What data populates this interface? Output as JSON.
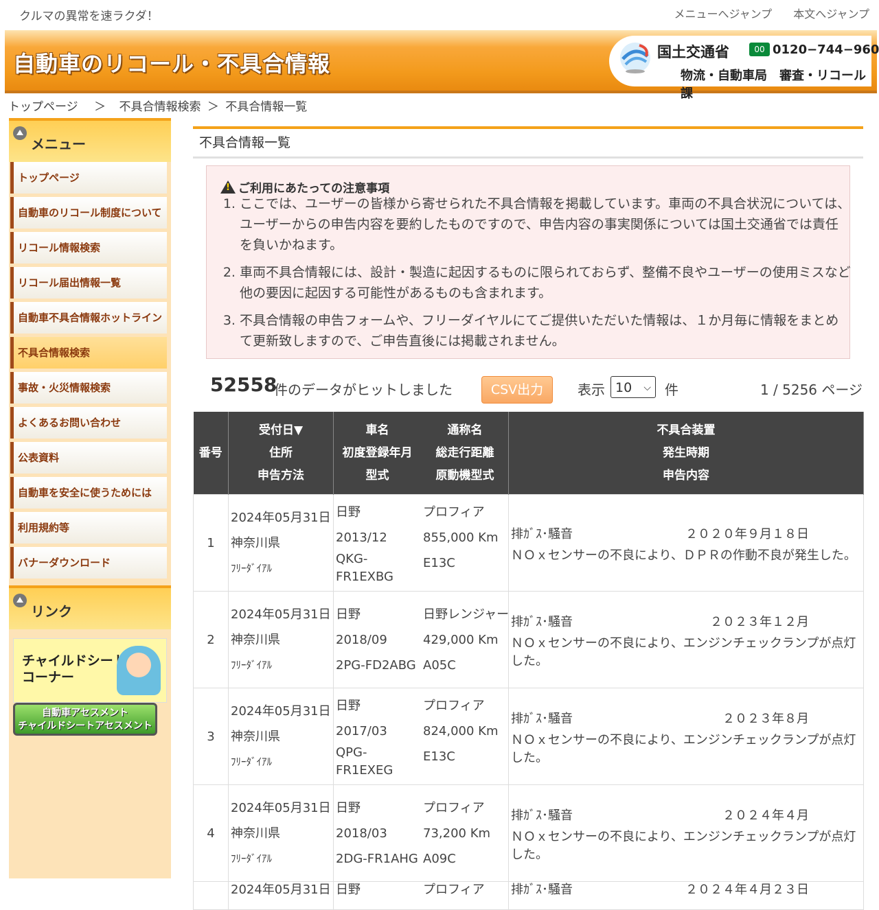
{
  "header": {
    "tagline": "クルマの異常を速ラクダ！",
    "links": [
      "メニューへジャンプ",
      "本文へジャンプ"
    ],
    "site_title": "自動車のリコール・不具合情報",
    "ministry": "国土交通省",
    "free_dial": "0120−744−960",
    "free_label": "フリーダイヤル",
    "bureau": "物流・自動車局　審査・リコール課"
  },
  "breadcrumb": [
    "トップページ",
    "＞",
    "不具合情報検索",
    "＞",
    "不具合情報一覧"
  ],
  "sidebar": {
    "menu_title": "メニュー",
    "items": [
      {
        "label": "トップページ",
        "active": false
      },
      {
        "label": "自動車のリコール制度について",
        "active": false
      },
      {
        "label": "リコール情報検索",
        "active": false
      },
      {
        "label": "リコール届出情報一覧",
        "active": false
      },
      {
        "label": "自動車不具合情報ホットライン",
        "active": false
      },
      {
        "label": "不具合情報検索",
        "active": true
      },
      {
        "label": "事故・火災情報検索",
        "active": false
      },
      {
        "label": "よくあるお問い合わせ",
        "active": false
      },
      {
        "label": "公表資料",
        "active": false
      },
      {
        "label": "自動車を安全に使うためには",
        "active": false
      },
      {
        "label": "利用規約等",
        "active": false
      },
      {
        "label": "バナーダウンロード",
        "active": false
      }
    ],
    "link_title": "リンク",
    "banner_child": "チャイルドシート\nコーナー",
    "banner_assess": "自動車アセスメント\nチャイルドシートアセスメント"
  },
  "main": {
    "page_title": "不具合情報一覧",
    "notice_title": "ご利用にあたっての注意事項",
    "notices": [
      "ここでは、ユーザーの皆様から寄せられた不具合情報を掲載しています。車両の不具合状況については、ユーザーからの申告内容を要約したものですので、申告内容の事実関係については国土交通省では責任を負いかねます。",
      "車両不具合情報には、設計・製造に起因するものに限られておらず、整備不良やユーザーの使用ミスなど他の要因に起因する可能性があるものも含まれます。",
      "不具合情報の申告フォームや、フリーダイヤルにてご提供いただいた情報は、１か月毎に情報をまとめて更新致しますので、ご申告直後には掲載されません。"
    ],
    "hit_count": "52558",
    "hit_text": "件のデータがヒットしました",
    "csv_label": "CSV出力",
    "show_label": "表示",
    "per_page": "10",
    "per_page_unit": "件",
    "pager": "1 / 5256 ページ"
  },
  "table": {
    "headers": {
      "no": "番号",
      "col2": [
        "受付日▼",
        "住所",
        "申告方法"
      ],
      "col3a": [
        "車名",
        "初度登録年月",
        "型式"
      ],
      "col3b": [
        "通称名",
        "総走行距離",
        "原動機型式"
      ],
      "col4": [
        "不具合装置",
        "発生時期",
        "申告内容"
      ]
    },
    "rows": [
      {
        "no": "1",
        "date": "2024年05月31日",
        "pref": "神奈川県",
        "method": "ﾌﾘｰﾀﾞｲｱﾙ",
        "maker": "日野",
        "reg": "2013/12",
        "model": "QKG-FR1EXBG",
        "name": "プロフィア",
        "mileage": "855,000 Km",
        "engine": "E13C",
        "device": "排ｶﾞｽ･騒音",
        "when": "２０２０年９月１８日",
        "desc": "ＮＯｘセンサーの不良により、ＤＰＲの作動不良が発生した。"
      },
      {
        "no": "2",
        "date": "2024年05月31日",
        "pref": "神奈川県",
        "method": "ﾌﾘｰﾀﾞｲｱﾙ",
        "maker": "日野",
        "reg": "2018/09",
        "model": "2PG-FD2ABG",
        "name": "日野レンジャー",
        "mileage": "429,000 Km",
        "engine": "A05C",
        "device": "排ｶﾞｽ･騒音",
        "when": "２０２３年１２月",
        "desc": "ＮＯｘセンサーの不良により、エンジンチェックランプが点灯した。"
      },
      {
        "no": "3",
        "date": "2024年05月31日",
        "pref": "神奈川県",
        "method": "ﾌﾘｰﾀﾞｲｱﾙ",
        "maker": "日野",
        "reg": "2017/03",
        "model": "QPG-FR1EXEG",
        "name": "プロフィア",
        "mileage": "824,000 Km",
        "engine": "E13C",
        "device": "排ｶﾞｽ･騒音",
        "when": "２０２３年８月",
        "desc": "ＮＯｘセンサーの不良により、エンジンチェックランプが点灯した。"
      },
      {
        "no": "4",
        "date": "2024年05月31日",
        "pref": "神奈川県",
        "method": "ﾌﾘｰﾀﾞｲｱﾙ",
        "maker": "日野",
        "reg": "2018/03",
        "model": "2DG-FR1AHG",
        "name": "プロフィア",
        "mileage": "73,200 Km",
        "engine": "A09C",
        "device": "排ｶﾞｽ･騒音",
        "when": "２０２４年４月",
        "desc": "ＮＯｘセンサーの不良により、エンジンチェックランプが点灯した。"
      },
      {
        "no": "",
        "date": "2024年05月31日",
        "pref": "",
        "method": "",
        "maker": "日野",
        "reg": "",
        "model": "",
        "name": "プロフィア",
        "mileage": "",
        "engine": "",
        "device": "排ｶﾞｽ･騒音",
        "when": "２０２４年４月２３日",
        "desc": ""
      }
    ]
  }
}
